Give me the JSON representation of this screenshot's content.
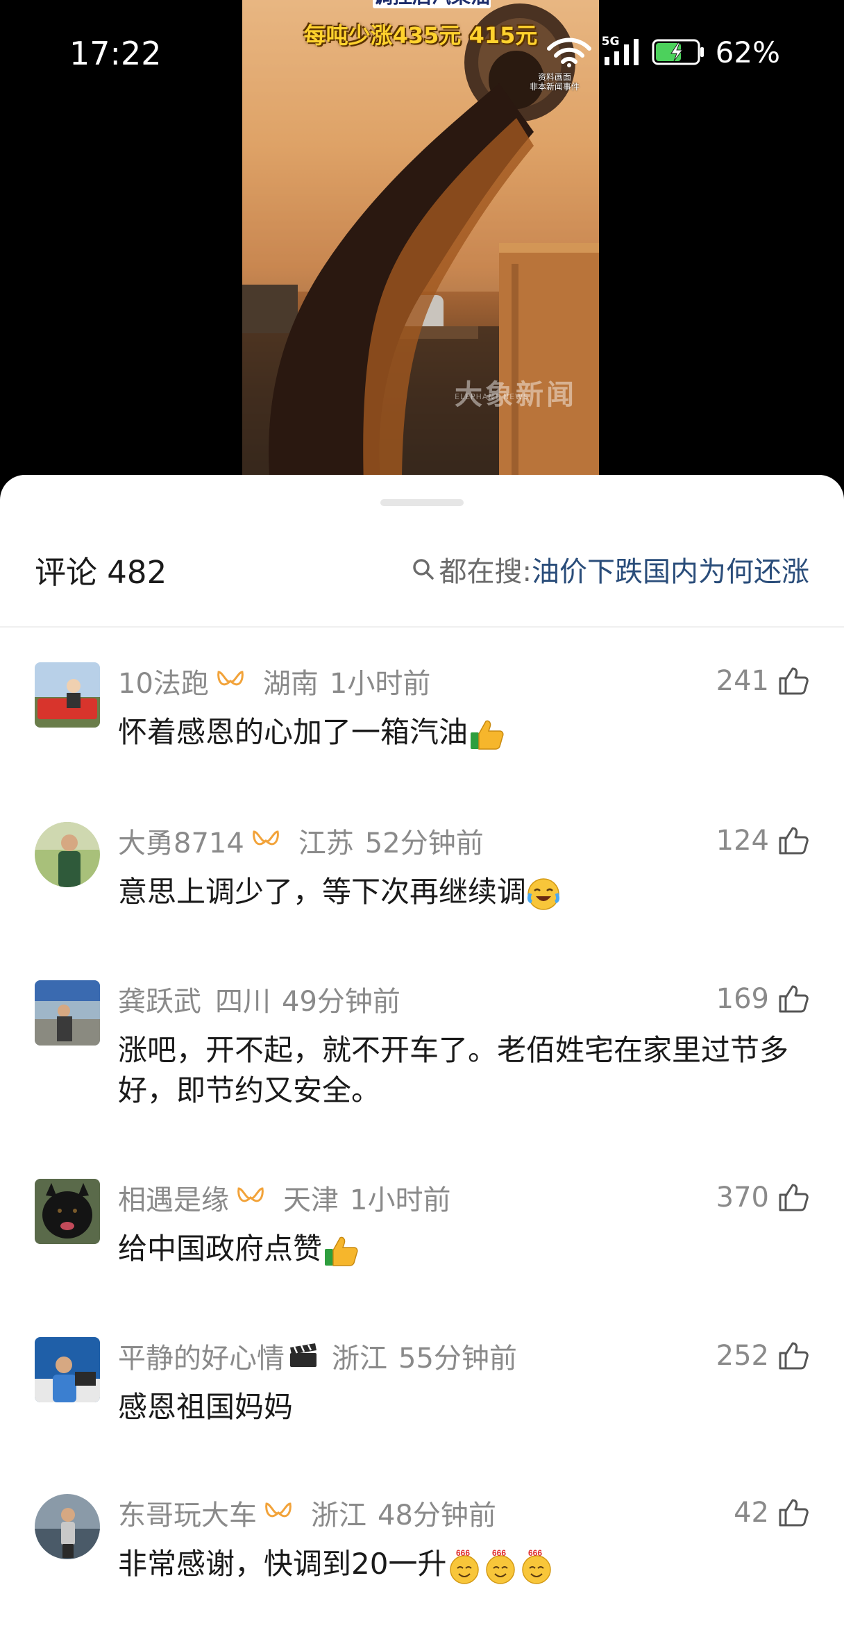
{
  "status_bar": {
    "time": "17:22",
    "network": "5G",
    "battery_percent": "62%"
  },
  "video": {
    "caption_top": "调控后汽柴油",
    "caption": "每吨少涨435元 415元",
    "watermark_line1": "资料画面",
    "watermark_line2": "非本新闻事件",
    "logo": "大象新闻",
    "logo_sub": "ELEPHANT NEWS"
  },
  "sheet": {
    "comment_count_label": "评论 482",
    "search_label": "都在搜:",
    "search_keyword": "油价下跌国内为何还涨"
  },
  "comments": [
    {
      "name": "10法跑",
      "location": "湖南",
      "time": "1小时前",
      "likes": "241",
      "text": "怀着感恩的心加了一箱汽油"
    },
    {
      "name": "大勇8714",
      "location": "江苏",
      "time": "52分钟前",
      "likes": "124",
      "text": "意思上调少了，等下次再继续调"
    },
    {
      "name": "龚跃武",
      "location": "四川",
      "time": "49分钟前",
      "likes": "169",
      "text": "涨吧，开不起，就不开车了。老佰姓宅在家里过节多好，即节约又安全。"
    },
    {
      "name": "相遇是缘",
      "location": "天津",
      "time": "1小时前",
      "likes": "370",
      "text": "给中国政府点赞"
    },
    {
      "name": "平静的好心情",
      "location": "浙江",
      "time": "55分钟前",
      "likes": "252",
      "text": "感恩祖国妈妈"
    },
    {
      "name": "东哥玩大车",
      "location": "浙江",
      "time": "48分钟前",
      "likes": "42",
      "text": "非常感谢，快调到20一升"
    }
  ],
  "colors": {
    "keyword_blue": "#2a4d7a",
    "meta_gray": "#8a8a8a",
    "badge_orange": "#f2a33a",
    "caption_yellow": "#ffd22e"
  }
}
